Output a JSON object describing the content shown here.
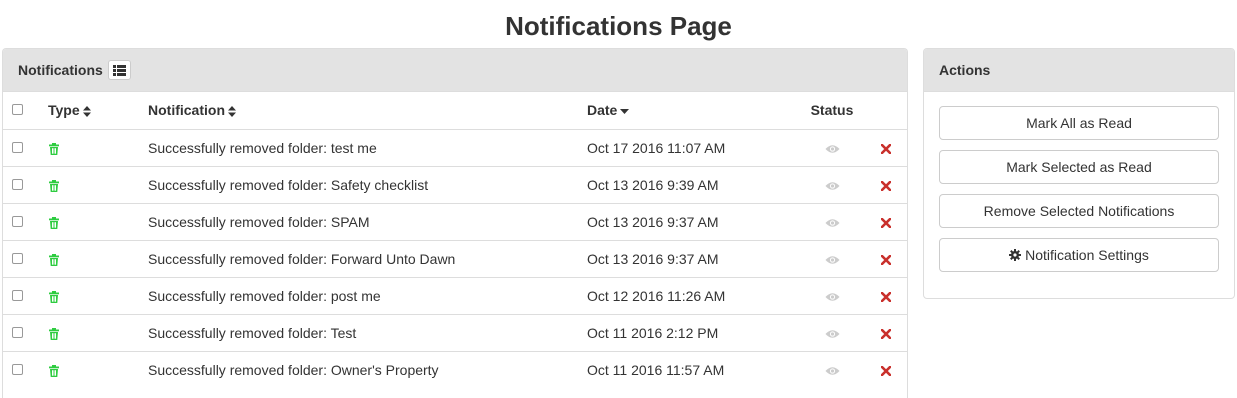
{
  "page": {
    "title": "Notifications Page"
  },
  "notifications_panel": {
    "title": "Notifications",
    "columns": {
      "type": "Type",
      "notification": "Notification",
      "date": "Date",
      "status": "Status"
    },
    "rows": [
      {
        "type_icon": "trash-icon",
        "notification": "Successfully removed folder: test me",
        "date": "Oct 17 2016 11:07 AM",
        "status_icon": "eye-icon"
      },
      {
        "type_icon": "trash-icon",
        "notification": "Successfully removed folder: Safety checklist",
        "date": "Oct 13 2016 9:39 AM",
        "status_icon": "eye-icon"
      },
      {
        "type_icon": "trash-icon",
        "notification": "Successfully removed folder: SPAM",
        "date": "Oct 13 2016 9:37 AM",
        "status_icon": "eye-icon"
      },
      {
        "type_icon": "trash-icon",
        "notification": "Successfully removed folder: Forward Unto Dawn",
        "date": "Oct 13 2016 9:37 AM",
        "status_icon": "eye-icon"
      },
      {
        "type_icon": "trash-icon",
        "notification": "Successfully removed folder: post me",
        "date": "Oct 12 2016 11:26 AM",
        "status_icon": "eye-icon"
      },
      {
        "type_icon": "trash-icon",
        "notification": "Successfully removed folder: Test",
        "date": "Oct 11 2016 2:12 PM",
        "status_icon": "eye-icon"
      },
      {
        "type_icon": "trash-icon",
        "notification": "Successfully removed folder: Owner's Property",
        "date": "Oct 11 2016 11:57 AM",
        "status_icon": "eye-icon"
      }
    ]
  },
  "actions_panel": {
    "title": "Actions",
    "buttons": {
      "mark_all": "Mark All as Read",
      "mark_selected": "Mark Selected as Read",
      "remove_selected": "Remove Selected Notifications",
      "settings": "Notification Settings"
    }
  },
  "colors": {
    "trash_icon": "#2ecc40",
    "delete_icon": "#c9302c",
    "eye_icon": "#cccccc",
    "heading_bg": "#e3e3e3"
  }
}
